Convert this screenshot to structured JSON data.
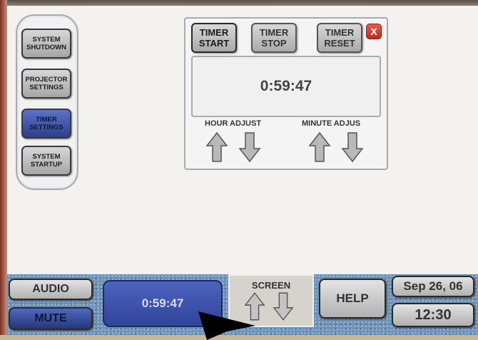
{
  "side_panel": {
    "items": [
      {
        "label_1": "SYSTEM",
        "label_2": "SHUTDOWN"
      },
      {
        "label_1": "PROJECTOR",
        "label_2": "SETTINGS"
      },
      {
        "label_1": "TIMER",
        "label_2": "SETTINGS"
      },
      {
        "label_1": "SYSTEM",
        "label_2": "STARTUP"
      }
    ]
  },
  "timer_panel": {
    "start": {
      "line1": "TIMER",
      "line2": "START"
    },
    "stop": {
      "line1": "TIMER",
      "line2": "STOP"
    },
    "reset": {
      "line1": "TIMER",
      "line2": "RESET"
    },
    "close_label": "X",
    "display": "0:59:47",
    "hour_adjust": "HOUR ADJUST",
    "minute_adjust": "MINUTE ADJUS"
  },
  "bottom_bar": {
    "audio": "AUDIO",
    "mute": "MUTE",
    "timer_readout": "0:59:47",
    "screen_label": "SCREEN",
    "help": "HELP",
    "date": "Sep 26, 06",
    "time": "12:30"
  },
  "icons": {
    "up": "up-arrow-icon",
    "down": "down-arrow-icon",
    "close": "close-icon",
    "cursor": "pointer-cursor"
  },
  "colors": {
    "active_button": "#3a4fa8",
    "close_button": "#d8392b",
    "bottom_bar": "#6f93b9"
  }
}
